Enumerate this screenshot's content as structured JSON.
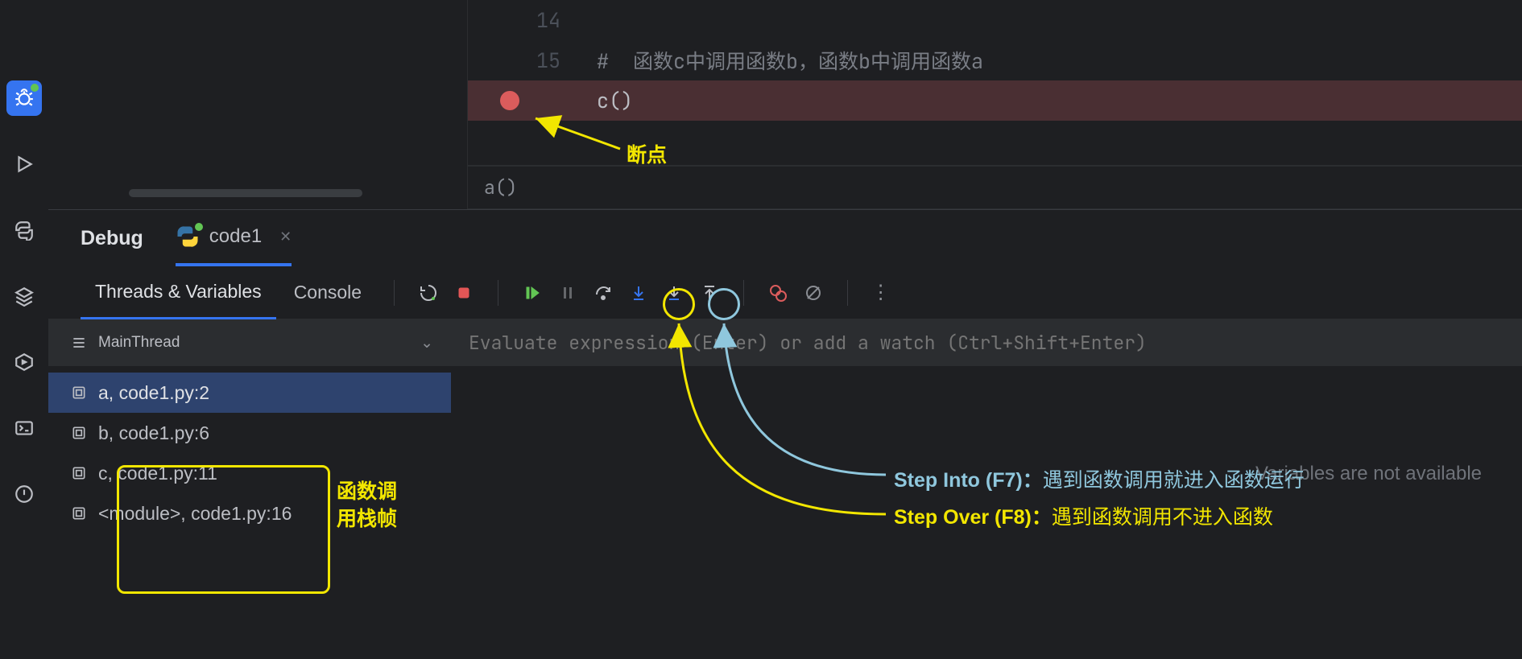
{
  "toolstrip": {
    "debug_icon": "bug-icon",
    "run_icon": "play-icon",
    "python_icon": "python-icon",
    "layers_icon": "layers-icon",
    "services_icon": "services-icon",
    "terminal_icon": "terminal-icon",
    "problems_icon": "warning-icon"
  },
  "editor": {
    "lines": [
      {
        "num": "14",
        "text": ""
      },
      {
        "num": "15",
        "text": "#  函数c中调用函数b，函数b中调用函数a"
      },
      {
        "num": "",
        "text": "c()",
        "breakpoint": true
      }
    ],
    "context": "a()"
  },
  "debug": {
    "title": "Debug",
    "tab": "code1",
    "subtabs": {
      "threads": "Threads & Variables",
      "console": "Console"
    },
    "thread": "MainThread",
    "frames": [
      "a, code1.py:2",
      "b, code1.py:6",
      "c, code1.py:11",
      "<module>, code1.py:16"
    ],
    "eval_placeholder": "Evaluate expression (Enter) or add a watch (Ctrl+Shift+Enter)",
    "vars_msg": "Variables are not available"
  },
  "annotations": {
    "breakpoint_label": "断点",
    "stack_label_l1": "函数调",
    "stack_label_l2": "用栈帧",
    "step_into_bold": "Step Into (F7)：",
    "step_into_rest": "遇到函数调用就进入函数运行",
    "step_over_bold": "Step Over (F8)：",
    "step_over_rest": "遇到函数调用不进入函数"
  }
}
